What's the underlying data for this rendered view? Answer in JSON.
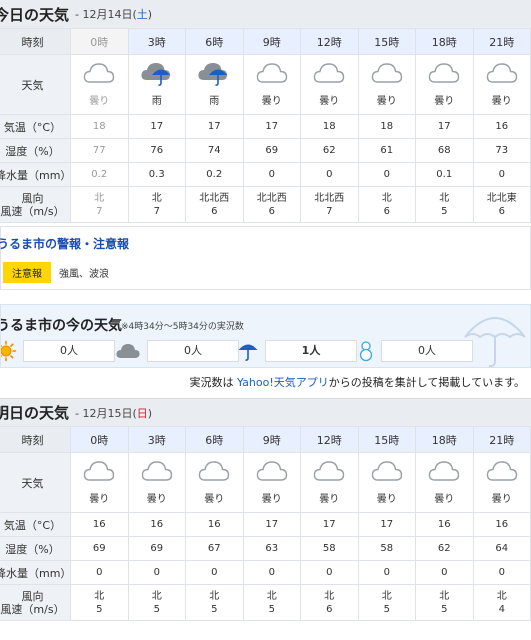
{
  "today": {
    "title": "今日の天気",
    "date_prefix": "- 12月14日(",
    "date_day": "土",
    "date_suffix": ")",
    "labels": {
      "time": "時刻",
      "weather": "天気",
      "temp": "気温（°C）",
      "humidity": "湿度（%）",
      "precip": "降水量（mm）",
      "wind": "風向\n風速（m/s）"
    },
    "times": [
      "0時",
      "3時",
      "6時",
      "9時",
      "12時",
      "15時",
      "18時",
      "21時"
    ],
    "weather_icons": [
      "cloud-icon",
      "rain-icon",
      "rain-icon",
      "cloud-icon",
      "cloud-icon",
      "cloud-icon",
      "cloud-icon",
      "cloud-icon"
    ],
    "weather": [
      "曇り",
      "雨",
      "雨",
      "曇り",
      "曇り",
      "曇り",
      "曇り",
      "曇り"
    ],
    "temp": [
      "18",
      "17",
      "17",
      "17",
      "18",
      "18",
      "17",
      "16"
    ],
    "humidity": [
      "77",
      "76",
      "74",
      "69",
      "62",
      "61",
      "68",
      "73"
    ],
    "precip": [
      "0.2",
      "0.3",
      "0.2",
      "0",
      "0",
      "0",
      "0.1",
      "0"
    ],
    "wind_dir": [
      "北",
      "北",
      "北北西",
      "北北西",
      "北北西",
      "北",
      "北",
      "北北東"
    ],
    "wind_speed": [
      "7",
      "7",
      "6",
      "6",
      "7",
      "6",
      "5",
      "6"
    ]
  },
  "warning": {
    "title": "うるま市の警報・注意報",
    "badge": "注意報",
    "text": "強風、波浪"
  },
  "now": {
    "title": "うるま市の今の天気",
    "subtitle": "※4時34分〜5時34分の実況数",
    "items": [
      {
        "icon": "sun-icon",
        "count": "0人"
      },
      {
        "icon": "cloud-icon",
        "count": "0人"
      },
      {
        "icon": "umbrella-icon",
        "count": "1人"
      },
      {
        "icon": "snowman-icon",
        "count": "0人"
      }
    ],
    "note_prefix": "実況数は ",
    "note_link": "Yahoo!天気アプリ",
    "note_suffix": "からの投稿を集計して掲載しています。"
  },
  "tomorrow": {
    "title": "明日の天気",
    "date_prefix": "- 12月15日(",
    "date_day": "日",
    "date_suffix": ")",
    "times": [
      "0時",
      "3時",
      "6時",
      "9時",
      "12時",
      "15時",
      "18時",
      "21時"
    ],
    "weather_icons": [
      "cloud-icon",
      "cloud-icon",
      "cloud-icon",
      "cloud-icon",
      "cloud-icon",
      "cloud-icon",
      "cloud-icon",
      "cloud-icon"
    ],
    "weather": [
      "曇り",
      "曇り",
      "曇り",
      "曇り",
      "曇り",
      "曇り",
      "曇り",
      "曇り"
    ],
    "temp": [
      "16",
      "16",
      "16",
      "17",
      "17",
      "17",
      "16",
      "16"
    ],
    "humidity": [
      "69",
      "69",
      "67",
      "63",
      "58",
      "58",
      "62",
      "64"
    ],
    "precip": [
      "0",
      "0",
      "0",
      "0",
      "0",
      "0",
      "0",
      "0"
    ],
    "wind_dir": [
      "北",
      "北",
      "北",
      "北",
      "北",
      "北",
      "北",
      "北"
    ],
    "wind_speed": [
      "5",
      "5",
      "5",
      "5",
      "6",
      "5",
      "5",
      "4"
    ]
  },
  "colors": {
    "accent": "#1a5fc4",
    "warning": "#ffd600",
    "time_header": "#e8efff",
    "label_bg": "#eef1f5"
  }
}
